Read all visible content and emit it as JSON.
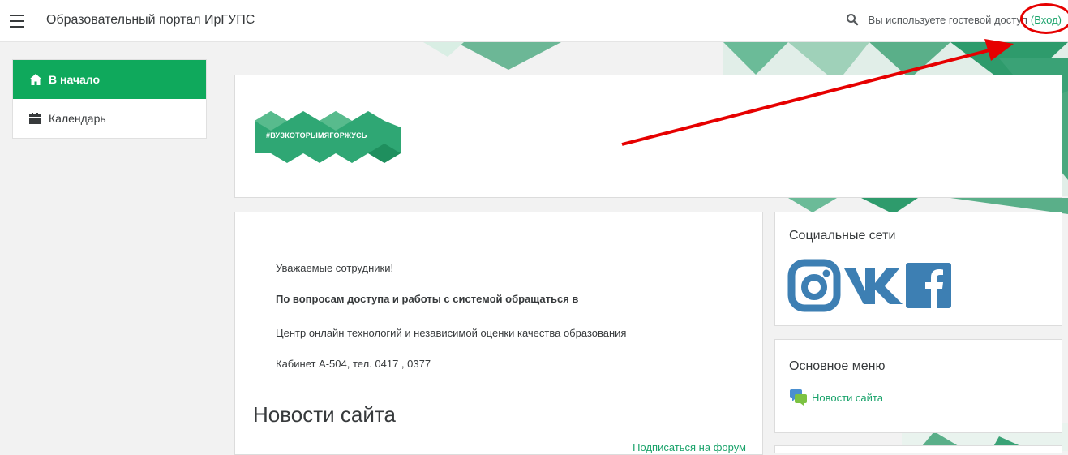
{
  "navbar": {
    "brand": "Образовательный портал ИрГУПС",
    "guest_text": "Вы используете гостевой доступ",
    "login_label": "(Вход)"
  },
  "drawer": {
    "items": [
      {
        "label": "В начало",
        "icon": "home-icon",
        "active": true
      },
      {
        "label": "Календарь",
        "icon": "calendar-icon",
        "active": false
      }
    ]
  },
  "header": {
    "badge_text": "#ВУЗКОТОРЫМЯГОРЖУСЬ"
  },
  "main": {
    "greeting": "Уважаемые сотрудники!",
    "contact_heading": "По вопросам доступа и работы с системой обращаться в",
    "center_name": "Центр онлайн технологий и независимой оценки качества образования",
    "office": "Кабинет А-504, тел. 0417 , 0377",
    "news_title": "Новости сайта",
    "subscribe_label": "Подписаться на форум"
  },
  "social": {
    "title": "Социальные сети",
    "icons": [
      "instagram-icon",
      "vk-icon",
      "facebook-icon"
    ]
  },
  "main_menu": {
    "title": "Основное меню",
    "link_label": "Новости сайта"
  },
  "colors": {
    "accent": "#0fa95c",
    "link": "#1aa36b",
    "annotation": "#e60000",
    "social": "#3d7fb3"
  }
}
